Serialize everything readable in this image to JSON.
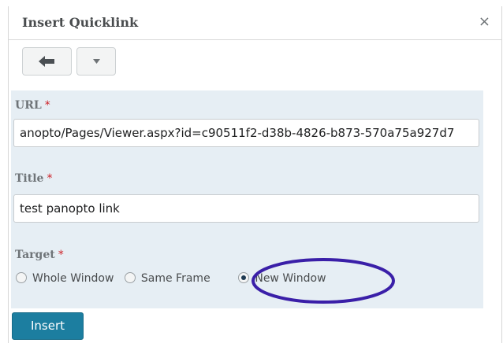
{
  "dialog": {
    "title": "Insert Quicklink",
    "close_glyph": "×"
  },
  "toolbar": {
    "back_icon": "back-arrow-icon",
    "menu_icon": "caret-down-icon"
  },
  "form": {
    "url": {
      "label": "URL",
      "required_mark": "*",
      "value": "anopto/Pages/Viewer.aspx?id=c90511f2-d38b-4826-b873-570a75a927d7"
    },
    "title": {
      "label": "Title",
      "required_mark": "*",
      "value": "test panopto link"
    },
    "target": {
      "label": "Target",
      "required_mark": "*",
      "options": [
        {
          "label": "Whole Window",
          "selected": false
        },
        {
          "label": "Same Frame",
          "selected": false
        },
        {
          "label": "New Window",
          "selected": true
        }
      ]
    }
  },
  "actions": {
    "insert_label": "Insert"
  },
  "colors": {
    "panel_bg": "#e6eef4",
    "required": "#cd2026",
    "primary_button": "#1c7ea0",
    "highlight_ellipse": "#3a1fa8"
  }
}
